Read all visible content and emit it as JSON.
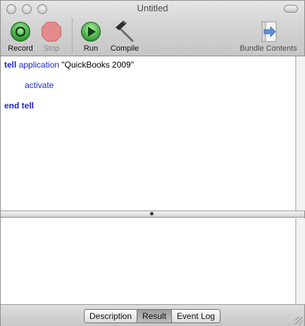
{
  "window": {
    "title": "Untitled"
  },
  "toolbar": {
    "record_label": "Record",
    "stop_label": "Stop",
    "run_label": "Run",
    "compile_label": "Compile",
    "bundle_label": "Bundle Contents"
  },
  "script": {
    "line1": {
      "tell": "tell",
      "application": "application",
      "string": "\"QuickBooks 2009\""
    },
    "line2": {
      "command": "activate"
    },
    "line3": {
      "end": "end tell"
    }
  },
  "tabs": {
    "description": "Description",
    "result": "Result",
    "event_log": "Event Log",
    "active": "Result"
  },
  "colors": {
    "keyword": "#1d24cc",
    "record_green": "#2f9a2f",
    "stop_red": "#e07070",
    "run_green": "#34a234"
  }
}
